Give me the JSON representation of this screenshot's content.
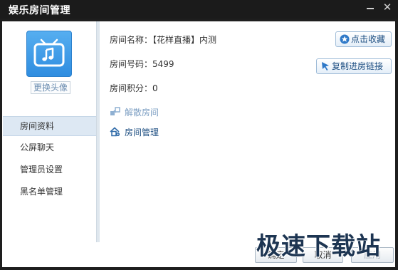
{
  "window": {
    "title": "娱乐房间管理",
    "minimize_glyph": "",
    "close_glyph": "✕"
  },
  "sidebar": {
    "change_avatar_label": "更换头像",
    "items": [
      {
        "label": "房间资料",
        "active": true
      },
      {
        "label": "公屏聊天",
        "active": false
      },
      {
        "label": "管理员设置",
        "active": false
      },
      {
        "label": "黑名单管理",
        "active": false
      }
    ]
  },
  "room": {
    "name_label": "房间名称：",
    "name_value": "【花样直播】内测",
    "number_label": "房间号码：",
    "number_value": "5499",
    "points_label": "房间积分：",
    "points_value": "0"
  },
  "actions": {
    "favorite_label": "点击收藏",
    "copy_link_label": "复制进房链接",
    "dissolve_label": "解散房间",
    "manage_label": "房间管理"
  },
  "footer": {
    "ok_label": "确定",
    "cancel_label": "取消",
    "apply_label": "应用"
  },
  "watermark": "极速下载站",
  "icons": {
    "avatar": "tv-music-icon",
    "favorite": "star-icon",
    "copy": "cursor-arrow-icon",
    "dissolve": "dissolve-room-icon",
    "manage": "house-gear-icon"
  },
  "colors": {
    "accent": "#2f8de0",
    "link": "#1e4f82",
    "disabled_link": "#7d9fc3",
    "nav_active_bg": "#dde8f3"
  }
}
